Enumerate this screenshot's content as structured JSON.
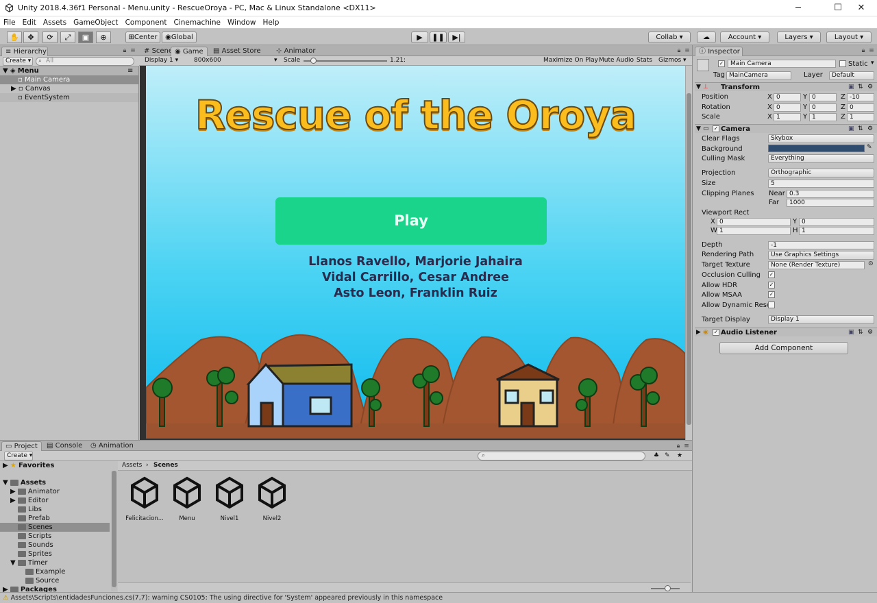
{
  "window": {
    "title": "Unity 2018.4.36f1 Personal - Menu.unity - RescueOroya - PC, Mac & Linux Standalone <DX11>",
    "minimize": "─",
    "maximize": "☐",
    "close": "✕"
  },
  "menu": [
    "File",
    "Edit",
    "Assets",
    "GameObject",
    "Component",
    "Cinemachine",
    "Window",
    "Help"
  ],
  "toolbar": {
    "pivot": "Center",
    "space": "Global",
    "collab": "Collab ▾",
    "account": "Account ▾",
    "layers": "Layers ▾",
    "layout": "Layout ▾"
  },
  "hierarchy": {
    "tab": "Hierarchy",
    "create": "Create ▾",
    "search_placeholder": "All",
    "scene": "Menu",
    "items": [
      "Main Camera",
      "Canvas",
      "EventSystem"
    ]
  },
  "gameview": {
    "tabs": [
      "Scene",
      "Game",
      "Asset Store",
      "Animator"
    ],
    "display": "Display 1",
    "resolution": "800x600",
    "scale_label": "Scale",
    "scale_value": "1.21:",
    "maximize": "Maximize On Play",
    "mute": "Mute Audio",
    "stats": "Stats",
    "gizmos": "Gizmos ▾"
  },
  "game": {
    "title": "Rescue of the Oroya",
    "play": "Play",
    "credits": [
      "Llanos Ravello, Marjorie Jahaira",
      "Vidal Carrillo, Cesar Andree",
      "Asto Leon, Franklin Ruiz"
    ]
  },
  "inspector": {
    "tab": "Inspector",
    "object_name": "Main Camera",
    "static_label": "Static",
    "tag_label": "Tag",
    "tag": "MainCamera",
    "layer_label": "Layer",
    "layer": "Default",
    "transform": {
      "title": "Transform",
      "rows": [
        {
          "label": "Position",
          "x": "0",
          "y": "0",
          "z": "-10"
        },
        {
          "label": "Rotation",
          "x": "0",
          "y": "0",
          "z": "0"
        },
        {
          "label": "Scale",
          "x": "1",
          "y": "1",
          "z": "1"
        }
      ]
    },
    "camera": {
      "title": "Camera",
      "clear_flags_label": "Clear Flags",
      "clear_flags": "Skybox",
      "background_label": "Background",
      "background_color": "#2f4b6e",
      "culling_label": "Culling Mask",
      "culling": "Everything",
      "projection_label": "Projection",
      "projection": "Orthographic",
      "size_label": "Size",
      "size": "5",
      "clip_label": "Clipping Planes",
      "near_label": "Near",
      "near": "0.3",
      "far_label": "Far",
      "far": "1000",
      "viewport_label": "Viewport Rect",
      "vx": "0",
      "vy": "0",
      "vw": "1",
      "vh": "1",
      "depth_label": "Depth",
      "depth": "-1",
      "rpath_label": "Rendering Path",
      "rpath": "Use Graphics Settings",
      "target_label": "Target Texture",
      "target": "None (Render Texture)",
      "occl_label": "Occlusion Culling",
      "hdr_label": "Allow HDR",
      "msaa_label": "Allow MSAA",
      "dyn_label": "Allow Dynamic Reso",
      "display_label": "Target Display",
      "display": "Display 1"
    },
    "audio": {
      "title": "Audio Listener"
    },
    "add_component": "Add Component"
  },
  "project": {
    "tabs": [
      "Project",
      "Console",
      "Animation"
    ],
    "create": "Create ▾",
    "favorites": "Favorites",
    "assets": "Assets",
    "folders": [
      "Animator",
      "Editor",
      "Libs",
      "Prefab",
      "Scenes",
      "Scripts",
      "Sounds",
      "Sprites",
      "Timer"
    ],
    "timer_children": [
      "Example",
      "Source"
    ],
    "packages": "Packages",
    "breadcrumb": [
      "Assets",
      "Scenes"
    ],
    "files": [
      "Felicitacion...",
      "Menu",
      "Nivel1",
      "Nivel2"
    ]
  },
  "status": "Assets\\Scripts\\entidadesFunciones.cs(7,7): warning CS0105: The using directive for 'System' appeared previously in this namespace"
}
